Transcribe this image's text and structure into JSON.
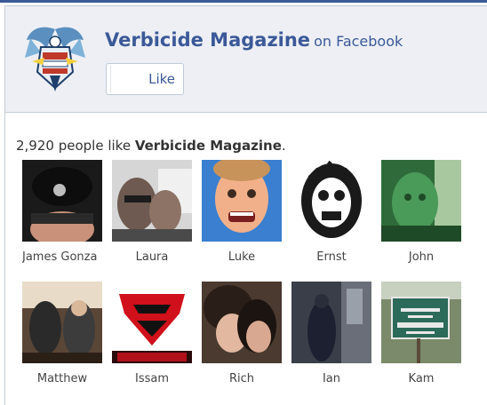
{
  "page": {
    "name": "Verbicide Magazine",
    "name_suffix": "on Facebook",
    "like_label": "Like"
  },
  "summary": {
    "count": "2,920",
    "text": " people like ",
    "page_name": "Verbicide Magazine",
    "end": "."
  },
  "fans": [
    {
      "name": "James Gonza"
    },
    {
      "name": "Laura"
    },
    {
      "name": "Luke"
    },
    {
      "name": "Ernst"
    },
    {
      "name": "John"
    },
    {
      "name": "Matthew"
    },
    {
      "name": "Issam"
    },
    {
      "name": "Rich"
    },
    {
      "name": "Ian"
    },
    {
      "name": "Kam"
    }
  ],
  "colors": {
    "facebook_blue": "#3b5998",
    "header_bg": "#edeff4",
    "border": "#c5cdd6"
  }
}
